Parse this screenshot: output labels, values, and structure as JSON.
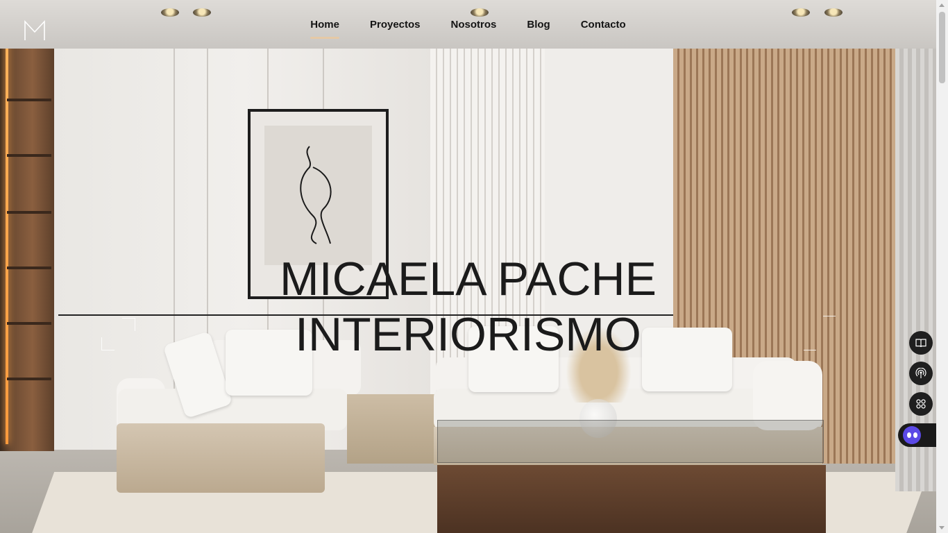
{
  "site": {
    "logo_icon": "m-monogram-logo-icon"
  },
  "nav": {
    "items": [
      {
        "label": "Home",
        "active": true
      },
      {
        "label": "Proyectos",
        "active": false
      },
      {
        "label": "Nosotros",
        "active": false
      },
      {
        "label": "Blog",
        "active": false
      },
      {
        "label": "Contacto",
        "active": false
      }
    ],
    "active_underline_color": "#e6c9a6"
  },
  "hero": {
    "line1": "MICAELA PACHE",
    "line2": "INTERIORISMO",
    "text_color": "#1b1b1b"
  },
  "floating_widgets": [
    {
      "icon": "book-icon"
    },
    {
      "icon": "broadcast-icon"
    },
    {
      "icon": "grid-icon"
    }
  ],
  "chat": {
    "icon": "chat-bot-icon",
    "accent": "#5b49e6"
  }
}
